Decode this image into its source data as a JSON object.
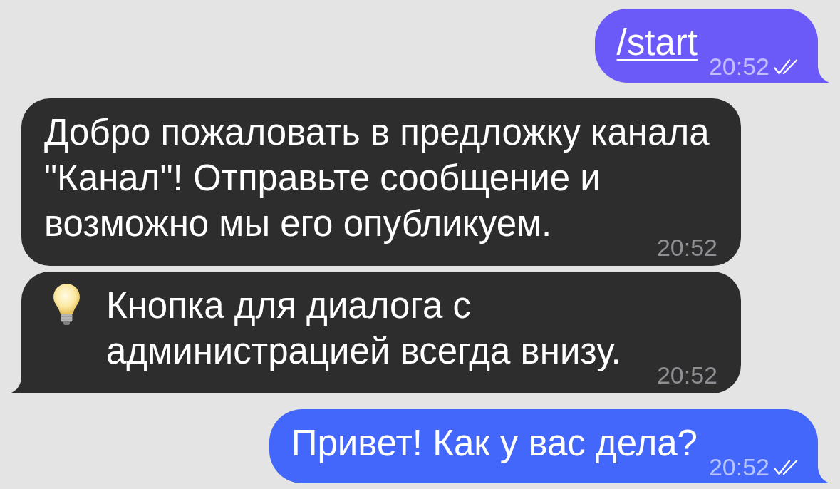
{
  "messages": [
    {
      "kind": "outgoing",
      "text": "/start",
      "link": true,
      "icon": false,
      "time": "20:52",
      "read": true,
      "tail": true,
      "color": "#6b5af7"
    },
    {
      "kind": "incoming",
      "text": "Добро пожаловать в предложку канала \"Канал\"! Отправьте сообщение и возможно мы его опубликуем.",
      "link": false,
      "icon": false,
      "time": "20:52",
      "tail": false,
      "color": "#2d2d2d"
    },
    {
      "kind": "incoming",
      "text": "Кнопка для диалога с администрацией всегда внизу.",
      "link": false,
      "icon": true,
      "time": "20:52",
      "tail": true,
      "color": "#2d2d2d"
    },
    {
      "kind": "outgoing",
      "text": "Привет! Как у вас дела?",
      "link": false,
      "icon": false,
      "time": "20:52",
      "read": true,
      "tail": true,
      "color": "#4467fb"
    }
  ]
}
